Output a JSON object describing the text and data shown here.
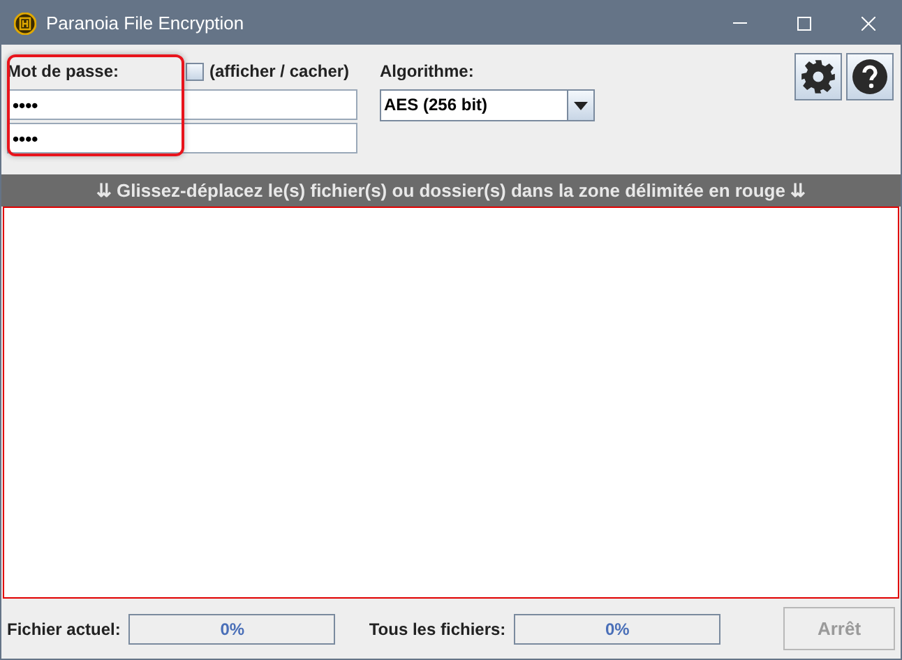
{
  "window": {
    "title": "Paranoia File Encryption"
  },
  "password": {
    "label": "Mot de passe:",
    "value": "••••",
    "confirm_value": "••••",
    "highlighted": true
  },
  "show_toggle": {
    "label": "(afficher / cacher)",
    "checked": false
  },
  "algorithm": {
    "label": "Algorithme:",
    "value": "AES (256 bit)"
  },
  "drop_banner": "⇊ Glissez-déplacez le(s) fichier(s) ou dossier(s) dans la zone délimitée en rouge ⇊",
  "progress": [
    {
      "label": "Fichier actuel:",
      "reading": "0%",
      "level": 0
    },
    {
      "label": "Tous les fichiers:",
      "reading": "0%",
      "level": 0
    }
  ],
  "stop_button": {
    "label": "Arrêt",
    "disabled": true
  }
}
